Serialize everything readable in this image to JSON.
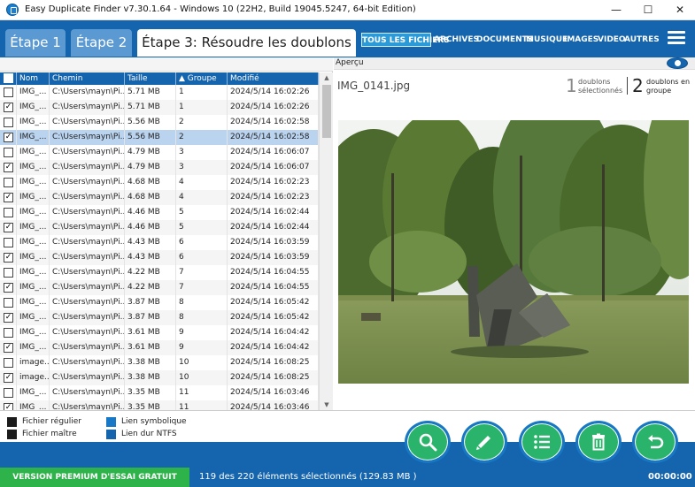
{
  "window": {
    "title": "Easy Duplicate Finder v7.30.1.64 - Windows 10 (22H2, Build 19045.5247, 64-bit Edition)",
    "minimize": "—",
    "maximize": "☐",
    "close": "✕"
  },
  "steps": [
    {
      "label": "Étape 1",
      "active": false
    },
    {
      "label": "Étape 2",
      "active": false
    },
    {
      "label": "Étape 3: Résoudre les doublons",
      "active": true
    }
  ],
  "categories": [
    "TOUS LES FICHIERS",
    "ARCHIVES",
    "DOCUMENTS",
    "MUSIQUE",
    "IMAGES",
    "VIDEO",
    "AUTRES"
  ],
  "table": {
    "columns": [
      "Nom",
      "Chemin",
      "Taille",
      "▲  Groupe",
      "Modifié"
    ],
    "rows": [
      {
        "checked": false,
        "name": "IMG_...",
        "path": "C:\\Users\\mayn\\Pi...",
        "size": "5.71 MB",
        "group": "1",
        "modified": "2024/5/14 16:02:26"
      },
      {
        "checked": true,
        "name": "IMG_...",
        "path": "C:\\Users\\mayn\\Pi...",
        "size": "5.71 MB",
        "group": "1",
        "modified": "2024/5/14 16:02:26"
      },
      {
        "checked": false,
        "name": "IMG_...",
        "path": "C:\\Users\\mayn\\Pi...",
        "size": "5.56 MB",
        "group": "2",
        "modified": "2024/5/14 16:02:58"
      },
      {
        "checked": true,
        "name": "IMG_...",
        "path": "C:\\Users\\mayn\\Pi...",
        "size": "5.56 MB",
        "group": "2",
        "modified": "2024/5/14 16:02:58",
        "selected": true
      },
      {
        "checked": false,
        "name": "IMG_...",
        "path": "C:\\Users\\mayn\\Pi...",
        "size": "4.79 MB",
        "group": "3",
        "modified": "2024/5/14 16:06:07"
      },
      {
        "checked": true,
        "name": "IMG_...",
        "path": "C:\\Users\\mayn\\Pi...",
        "size": "4.79 MB",
        "group": "3",
        "modified": "2024/5/14 16:06:07"
      },
      {
        "checked": false,
        "name": "IMG_...",
        "path": "C:\\Users\\mayn\\Pi...",
        "size": "4.68 MB",
        "group": "4",
        "modified": "2024/5/14 16:02:23"
      },
      {
        "checked": true,
        "name": "IMG_...",
        "path": "C:\\Users\\mayn\\Pi...",
        "size": "4.68 MB",
        "group": "4",
        "modified": "2024/5/14 16:02:23"
      },
      {
        "checked": false,
        "name": "IMG_...",
        "path": "C:\\Users\\mayn\\Pi...",
        "size": "4.46 MB",
        "group": "5",
        "modified": "2024/5/14 16:02:44"
      },
      {
        "checked": true,
        "name": "IMG_...",
        "path": "C:\\Users\\mayn\\Pi...",
        "size": "4.46 MB",
        "group": "5",
        "modified": "2024/5/14 16:02:44"
      },
      {
        "checked": false,
        "name": "IMG_...",
        "path": "C:\\Users\\mayn\\Pi...",
        "size": "4.43 MB",
        "group": "6",
        "modified": "2024/5/14 16:03:59"
      },
      {
        "checked": true,
        "name": "IMG_...",
        "path": "C:\\Users\\mayn\\Pi...",
        "size": "4.43 MB",
        "group": "6",
        "modified": "2024/5/14 16:03:59"
      },
      {
        "checked": false,
        "name": "IMG_...",
        "path": "C:\\Users\\mayn\\Pi...",
        "size": "4.22 MB",
        "group": "7",
        "modified": "2024/5/14 16:04:55"
      },
      {
        "checked": true,
        "name": "IMG_...",
        "path": "C:\\Users\\mayn\\Pi...",
        "size": "4.22 MB",
        "group": "7",
        "modified": "2024/5/14 16:04:55"
      },
      {
        "checked": false,
        "name": "IMG_...",
        "path": "C:\\Users\\mayn\\Pi...",
        "size": "3.87 MB",
        "group": "8",
        "modified": "2024/5/14 16:05:42"
      },
      {
        "checked": true,
        "name": "IMG_...",
        "path": "C:\\Users\\mayn\\Pi...",
        "size": "3.87 MB",
        "group": "8",
        "modified": "2024/5/14 16:05:42"
      },
      {
        "checked": false,
        "name": "IMG_...",
        "path": "C:\\Users\\mayn\\Pi...",
        "size": "3.61 MB",
        "group": "9",
        "modified": "2024/5/14 16:04:42"
      },
      {
        "checked": true,
        "name": "IMG_...",
        "path": "C:\\Users\\mayn\\Pi...",
        "size": "3.61 MB",
        "group": "9",
        "modified": "2024/5/14 16:04:42"
      },
      {
        "checked": false,
        "name": "image...",
        "path": "C:\\Users\\mayn\\Pi...",
        "size": "3.38 MB",
        "group": "10",
        "modified": "2024/5/14 16:08:25"
      },
      {
        "checked": true,
        "name": "image...",
        "path": "C:\\Users\\mayn\\Pi...",
        "size": "3.38 MB",
        "group": "10",
        "modified": "2024/5/14 16:08:25"
      },
      {
        "checked": false,
        "name": "IMG_...",
        "path": "C:\\Users\\mayn\\Pi...",
        "size": "3.35 MB",
        "group": "11",
        "modified": "2024/5/14 16:03:46"
      },
      {
        "checked": true,
        "name": "IMG_...",
        "path": "C:\\Users\\mayn\\Pi...",
        "size": "3.35 MB",
        "group": "11",
        "modified": "2024/5/14 16:03:46"
      }
    ]
  },
  "preview": {
    "label": "Aperçu",
    "filename": "IMG_0141.jpg",
    "selected_count": "1",
    "selected_label_1": "doublons",
    "selected_label_2": "sélectionnés",
    "group_count": "2",
    "group_label_1": "doublons en",
    "group_label_2": "groupe"
  },
  "legend": {
    "regular": "Fichier régulier",
    "master": "Fichier maître",
    "symlink": "Lien symbolique",
    "hardlink": "Lien dur NTFS"
  },
  "actions": [
    "search-icon",
    "pencil-icon",
    "list-icon",
    "trash-icon",
    "undo-icon"
  ],
  "status": {
    "premium": "VERSION PREMIUM D'ESSAI GRATUIT",
    "selection": "119 des 220 éléments sélectionnés (129.83 MB )",
    "timer": "00:00:00"
  },
  "colors": {
    "brand_blue": "#1464ae",
    "action_green": "#2ab36a",
    "premium_green": "#2db34a",
    "selected_row": "#bad3ef"
  }
}
